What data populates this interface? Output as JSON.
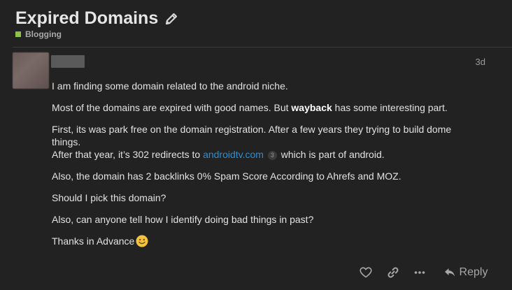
{
  "topic": {
    "title": "Expired Domains",
    "category": "Blogging",
    "category_color": "#8fc04a"
  },
  "post": {
    "date": "3d",
    "p1": "I am finding some domain related to the android niche.",
    "p2_before": "Most of the domains are expired with good names. But ",
    "p2_bold": "wayback",
    "p2_after": " has some interesting part.",
    "p3_line1": "First, its was park free on the domain registration. After a few years they trying to build dome things.",
    "p3_line2_before": "After that year, it’s 302 redirects to ",
    "p3_link": "androidtv.com",
    "p3_clicks": "3",
    "p3_line2_after": " which is part of android.",
    "p4": "Also, the domain has 2 backlinks 0% Spam Score According to Ahrefs and MOZ.",
    "p5": "Should I pick this domain?",
    "p6": "Also, can anyone tell how I identify doing bad things in past?",
    "p7": "Thanks in Advance"
  },
  "actions": {
    "reply_label": "Reply"
  },
  "icons": [
    "pencil-icon",
    "heart-icon",
    "link-icon",
    "more-icon",
    "reply-icon",
    "smiley-icon"
  ]
}
